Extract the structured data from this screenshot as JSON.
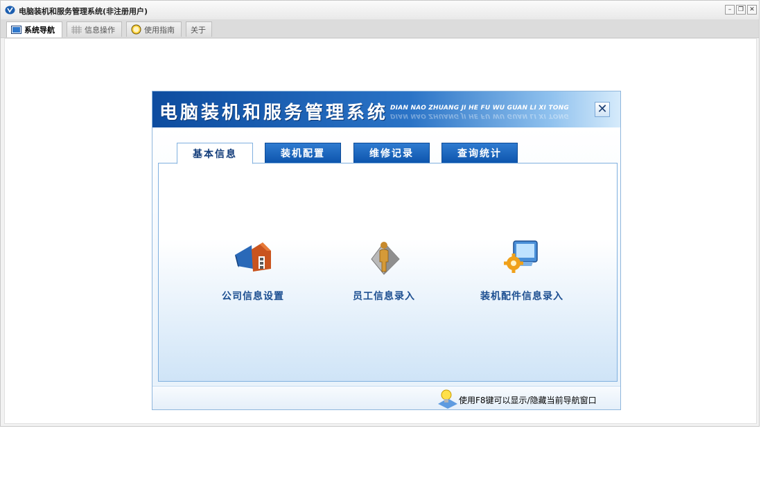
{
  "window": {
    "title": "电脑装机和服务管理系统(非注册用户)",
    "controls": [
      "minimize",
      "restore",
      "close"
    ]
  },
  "tabs": [
    {
      "label": "系统导航",
      "icon": "monitor-icon",
      "active": true
    },
    {
      "label": "信息操作",
      "icon": "grid-icon",
      "active": false
    },
    {
      "label": "使用指南",
      "icon": "clock-icon",
      "active": false
    },
    {
      "label": "关于",
      "active": false
    }
  ],
  "nav": {
    "title": "电脑装机和服务管理系统",
    "pinyin": "DIAN NAO ZHUANG JI HE FU WU GUAN LI XI TONG",
    "close_label": "✕",
    "categories": [
      {
        "label": "基本信息",
        "selected": true
      },
      {
        "label": "装机配置",
        "selected": false
      },
      {
        "label": "维修记录",
        "selected": false
      },
      {
        "label": "查询统计",
        "selected": false
      }
    ],
    "items": [
      {
        "label": "公司信息设置",
        "icon": "company-book-icon"
      },
      {
        "label": "员工信息录入",
        "icon": "employee-figure-icon"
      },
      {
        "label": "装机配件信息录入",
        "icon": "computer-gear-icon"
      }
    ],
    "tip": "使用F8键可以显示/隐藏当前导航窗口"
  },
  "colors": {
    "header_dark": "#0d4c9f",
    "header_light": "#d6ebfb",
    "label_blue": "#1d4f91",
    "tab_blue": "#0d55ad"
  }
}
